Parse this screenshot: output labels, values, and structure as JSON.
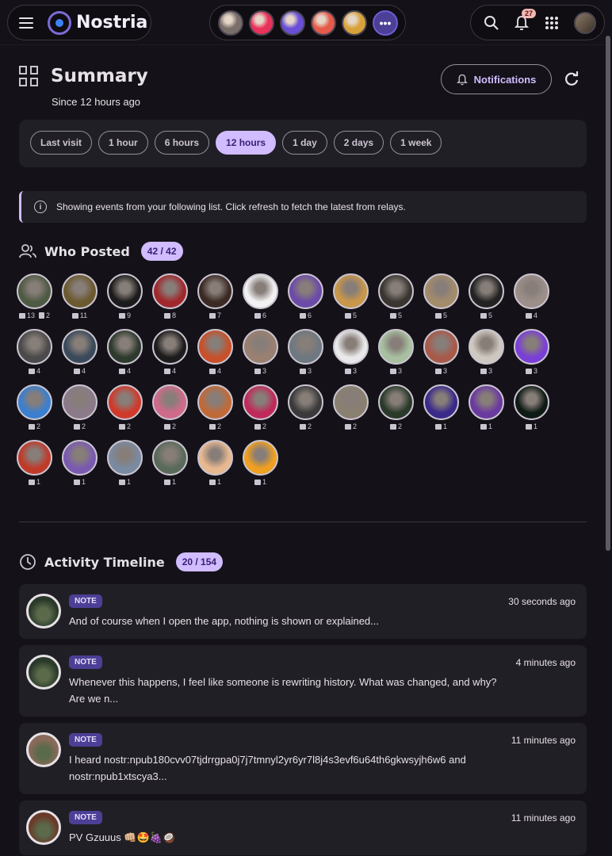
{
  "app": {
    "name": "Nostria",
    "notification_count": "27"
  },
  "header": {
    "menu_icon": "hamburger-menu-icon",
    "top_avatars": [
      "#7a6e6a",
      "#e8325a",
      "#6a4fd6",
      "#e55a4a",
      "#d8a23a"
    ],
    "more_label": "•••"
  },
  "summary": {
    "title": "Summary",
    "since": "Since 12 hours ago",
    "notifications_label": "Notifications",
    "ranges": [
      "Last visit",
      "1 hour",
      "6 hours",
      "12 hours",
      "1 day",
      "2 days",
      "1 week"
    ],
    "active_range": "12 hours",
    "info": "Showing events from your following list. Click refresh to fetch the latest from relays."
  },
  "who_posted": {
    "title": "Who Posted",
    "count": "42 / 42",
    "posters": [
      {
        "c": "13",
        "extra": "2",
        "color": "#4e5a43"
      },
      {
        "c": "11",
        "color": "#6b5a2f"
      },
      {
        "c": "9",
        "color": "#1b1b1b"
      },
      {
        "c": "8",
        "color": "#a0282d"
      },
      {
        "c": "7",
        "color": "#3b2a24"
      },
      {
        "c": "6",
        "color": "#f1f1f1"
      },
      {
        "c": "6",
        "color": "#6c4aa8"
      },
      {
        "c": "5",
        "color": "#c9974a"
      },
      {
        "c": "5",
        "color": "#3a3530"
      },
      {
        "c": "5",
        "color": "#a38c6b"
      },
      {
        "c": "5",
        "color": "#222222"
      },
      {
        "c": "4",
        "color": "#9c8f8a"
      },
      {
        "c": "4",
        "color": "#4a4a4a"
      },
      {
        "c": "4",
        "color": "#3a4a5a"
      },
      {
        "c": "4",
        "color": "#2e3a2e"
      },
      {
        "c": "4",
        "color": "#1c1c1c"
      },
      {
        "c": "4",
        "color": "#c8502a"
      },
      {
        "c": "3",
        "color": "#9a8070"
      },
      {
        "c": "3",
        "color": "#6e7880"
      },
      {
        "c": "3",
        "color": "#e9e9e9"
      },
      {
        "c": "3",
        "color": "#a8c0a0"
      },
      {
        "c": "3",
        "color": "#a85a4a"
      },
      {
        "c": "3",
        "color": "#cfc8c0"
      },
      {
        "c": "3",
        "color": "#7a3fd6"
      },
      {
        "c": "2",
        "color": "#3a7fd0"
      },
      {
        "c": "2",
        "color": "#8a7a8a"
      },
      {
        "c": "2",
        "color": "#d03a2a"
      },
      {
        "c": "2",
        "color": "#d06a8a"
      },
      {
        "c": "2",
        "color": "#c06a3a"
      },
      {
        "c": "2",
        "color": "#c02a5a"
      },
      {
        "c": "2",
        "color": "#3a3a3a"
      },
      {
        "c": "2",
        "color": "#8a8070"
      },
      {
        "c": "2",
        "color": "#2a3a2a"
      },
      {
        "c": "1",
        "color": "#3a2a8a"
      },
      {
        "c": "1",
        "color": "#6a3aa0"
      },
      {
        "c": "1",
        "color": "#0e1a14"
      },
      {
        "c": "1",
        "color": "#c03a2a"
      },
      {
        "c": "1",
        "color": "#7a5ab0"
      },
      {
        "c": "1",
        "color": "#7a8aa0"
      },
      {
        "c": "1",
        "color": "#5a6a5a"
      },
      {
        "c": "1",
        "color": "#e8b890"
      },
      {
        "c": "1",
        "color": "#f0a020"
      }
    ]
  },
  "timeline": {
    "title": "Activity Timeline",
    "count": "20 / 154",
    "items": [
      {
        "type": "NOTE",
        "time": "30 seconds ago",
        "text": "And of course when I open the app, nothing is shown or explained...",
        "color": "#2a3a2a"
      },
      {
        "type": "NOTE",
        "time": "4 minutes ago",
        "text": "Whenever this happens, I feel like someone is rewriting history. What was changed, and why? Are we n...",
        "color": "#2a3a2a"
      },
      {
        "type": "NOTE",
        "time": "11 minutes ago",
        "text": "I heard nostr:npub180cvv07tjdrrgpa0j7j7tmnyl2yr6yr7l8j4s3evf6u64th6gkwsyjh6w6 and nostr:npub1xtscya3...",
        "color": "#8a6a5a"
      },
      {
        "type": "NOTE",
        "time": "11 minutes ago",
        "text": "PV Gzuuus 👊🏼🤩🍇🥥",
        "color": "#6a3a2a"
      }
    ]
  }
}
